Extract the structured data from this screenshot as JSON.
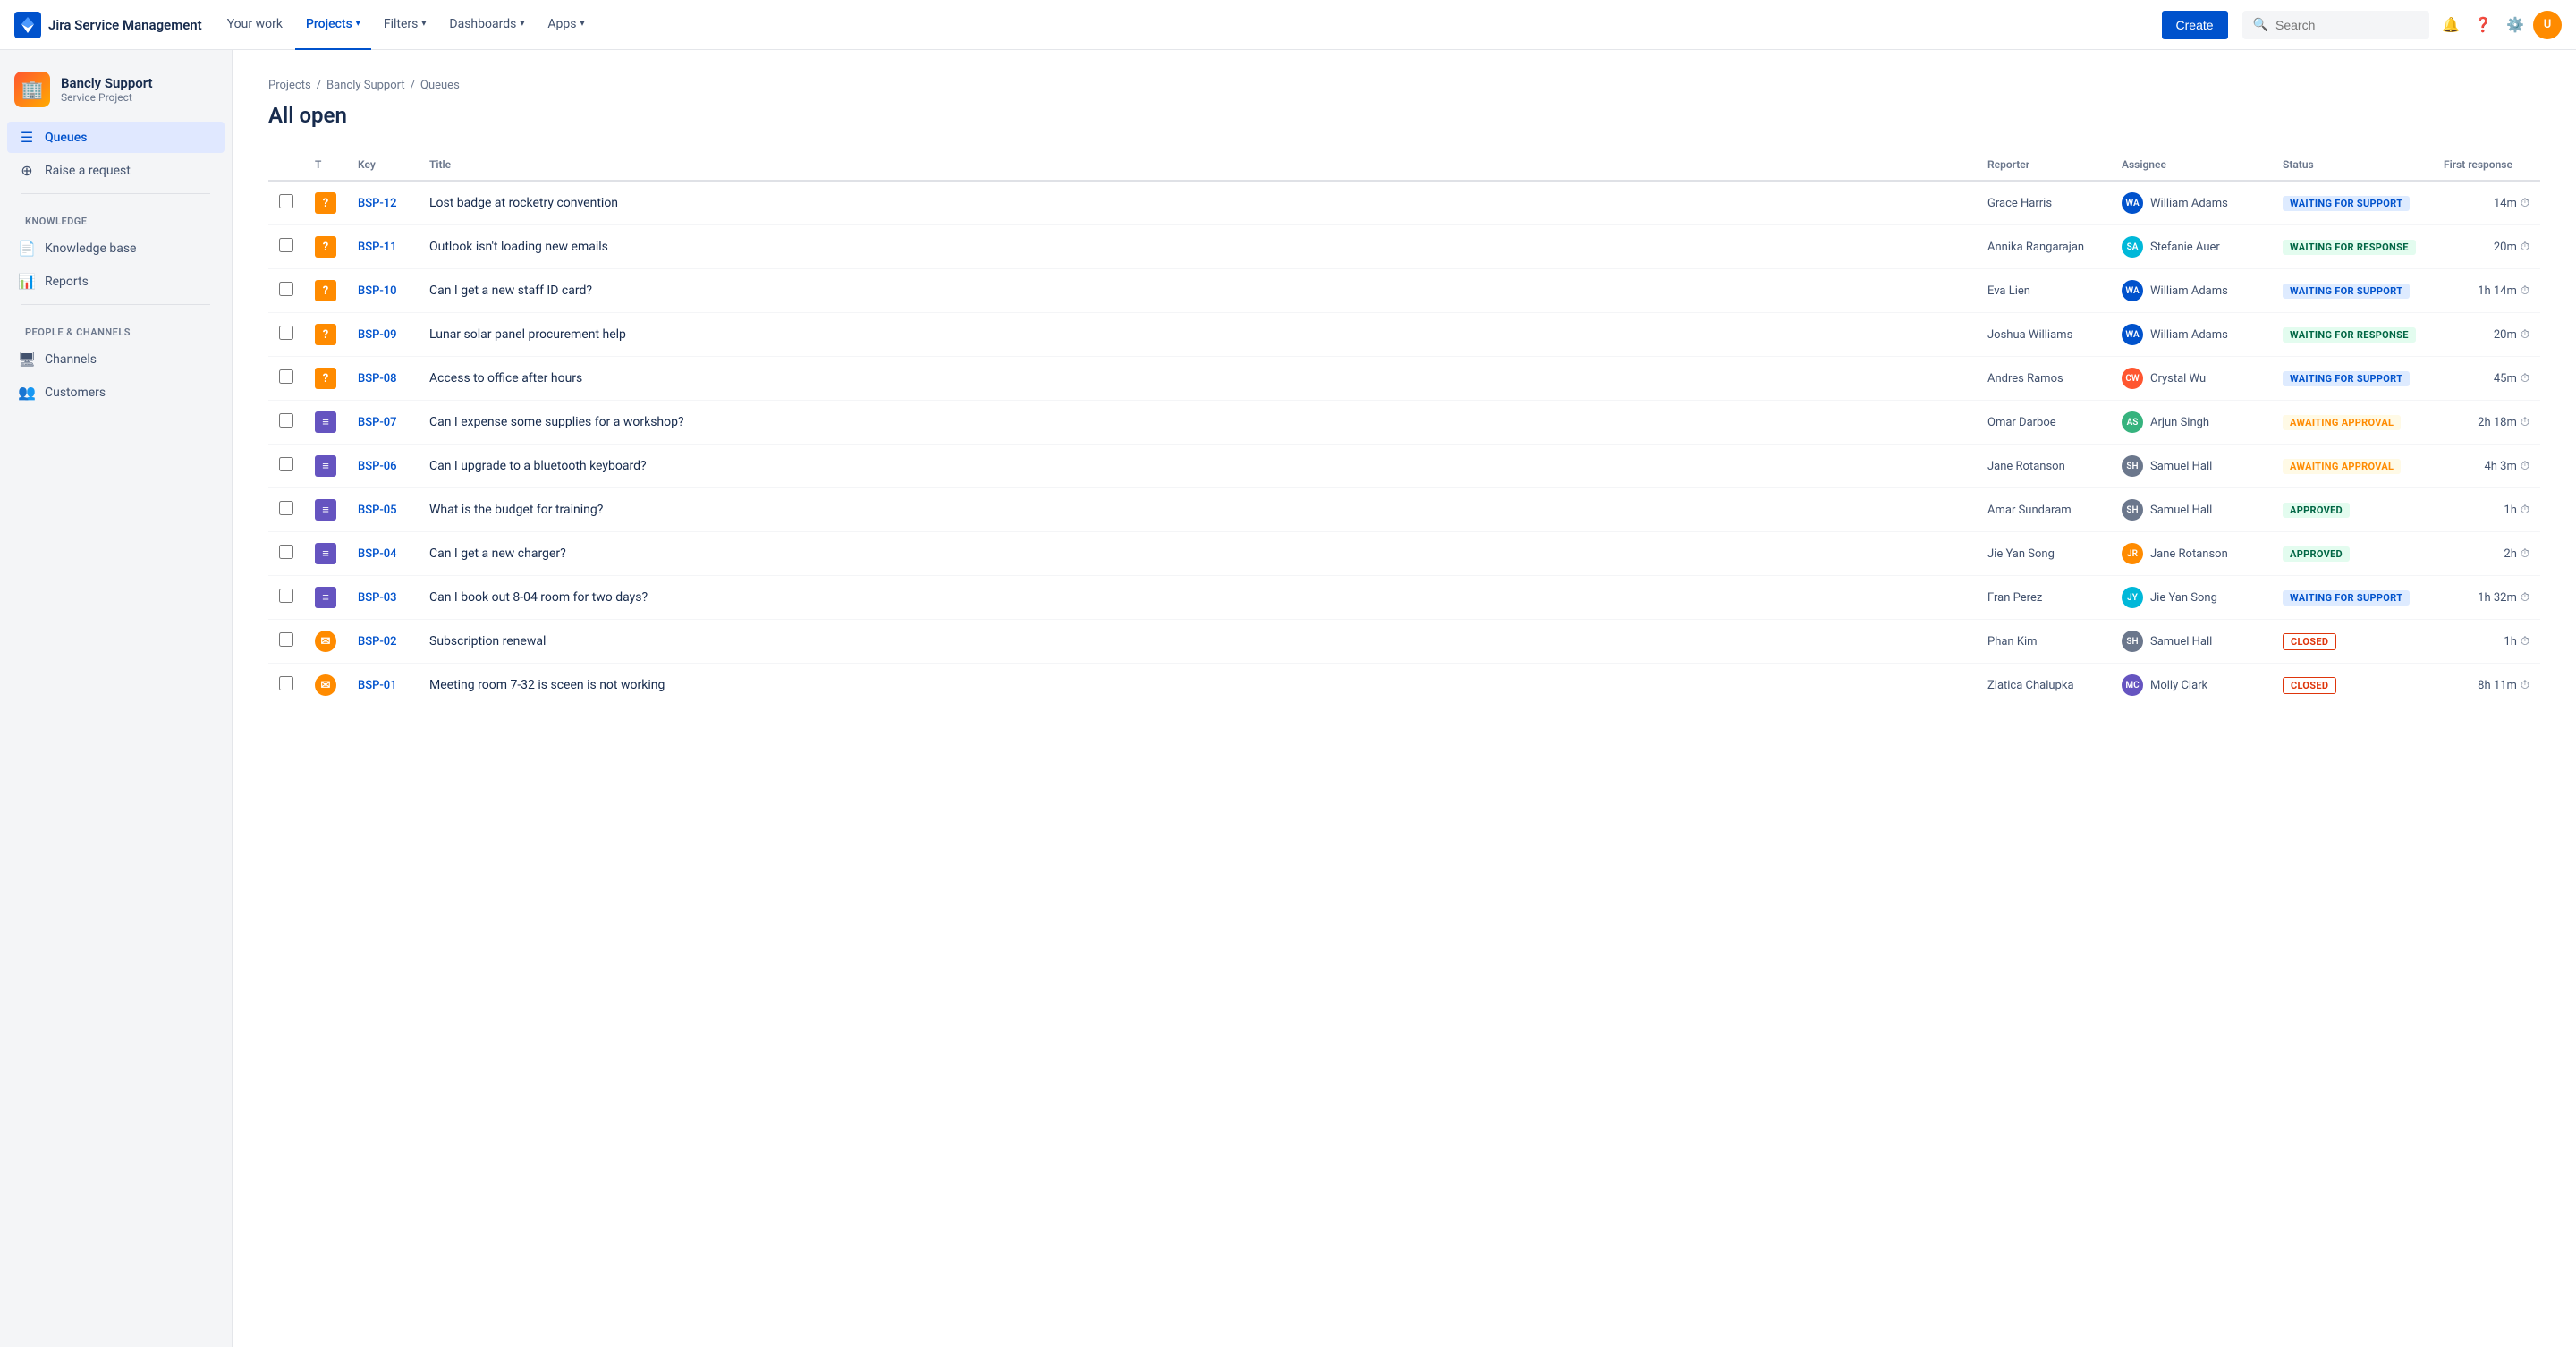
{
  "app": {
    "name": "Jira Service Management",
    "logo_emoji": "⚡"
  },
  "topnav": {
    "your_work": "Your work",
    "projects": "Projects",
    "filters": "Filters",
    "dashboards": "Dashboards",
    "apps": "Apps",
    "create": "Create",
    "search_placeholder": "Search"
  },
  "sidebar": {
    "project_name": "Bancly Support",
    "project_type": "Service Project",
    "items": [
      {
        "label": "Queues",
        "icon": "☰",
        "active": true
      },
      {
        "label": "Raise a request",
        "icon": "⊕",
        "active": false
      }
    ],
    "sections": [
      {
        "label": "KNOWLEDGE",
        "items": [
          {
            "label": "Knowledge base",
            "icon": "📄"
          },
          {
            "label": "Reports",
            "icon": "📊"
          }
        ]
      },
      {
        "label": "PEOPLE & CHANNELS",
        "items": [
          {
            "label": "Channels",
            "icon": "🖥"
          },
          {
            "label": "Customers",
            "icon": "👥"
          }
        ]
      }
    ]
  },
  "breadcrumb": {
    "items": [
      "Projects",
      "Bancly Support",
      "Queues"
    ]
  },
  "page_title": "All open",
  "table": {
    "columns": [
      "",
      "T",
      "Key",
      "Title",
      "Reporter",
      "Assignee",
      "Status",
      "First response"
    ],
    "rows": [
      {
        "key": "BSP-12",
        "type": "question",
        "title": "Lost badge at rocketry convention",
        "reporter": "Grace Harris",
        "assignee": "William Adams",
        "assignee_initials": "WA",
        "assignee_color": "av-blue",
        "status": "WAITING FOR SUPPORT",
        "status_class": "status-waiting-support",
        "first_response": "14m"
      },
      {
        "key": "BSP-11",
        "type": "question",
        "title": "Outlook isn't loading new emails",
        "reporter": "Annika Rangarajan",
        "assignee": "Stefanie Auer",
        "assignee_initials": "SA",
        "assignee_color": "av-teal",
        "status": "WAITING FOR RESPONSE",
        "status_class": "status-waiting-response",
        "first_response": "20m"
      },
      {
        "key": "BSP-10",
        "type": "question",
        "title": "Can I get a new staff ID card?",
        "reporter": "Eva Lien",
        "assignee": "William Adams",
        "assignee_initials": "WA",
        "assignee_color": "av-blue",
        "status": "WAITING FOR SUPPORT",
        "status_class": "status-waiting-support",
        "first_response": "1h 14m"
      },
      {
        "key": "BSP-09",
        "type": "question",
        "title": "Lunar solar panel procurement help",
        "reporter": "Joshua Williams",
        "assignee": "William Adams",
        "assignee_initials": "WA",
        "assignee_color": "av-blue",
        "status": "WAITING FOR RESPONSE",
        "status_class": "status-waiting-response",
        "first_response": "20m"
      },
      {
        "key": "BSP-08",
        "type": "question",
        "title": "Access to office after hours",
        "reporter": "Andres Ramos",
        "assignee": "Crystal Wu",
        "assignee_initials": "CW",
        "assignee_color": "av-pink",
        "status": "WAITING FOR SUPPORT",
        "status_class": "status-waiting-support",
        "first_response": "45m"
      },
      {
        "key": "BSP-07",
        "type": "task",
        "title": "Can I expense some supplies for a workshop?",
        "reporter": "Omar Darboe",
        "assignee": "Arjun Singh",
        "assignee_initials": "AS",
        "assignee_color": "av-green",
        "status": "AWAITING APPROVAL",
        "status_class": "status-awaiting-approval",
        "first_response": "2h 18m"
      },
      {
        "key": "BSP-06",
        "type": "task",
        "title": "Can I upgrade to a bluetooth keyboard?",
        "reporter": "Jane Rotanson",
        "assignee": "Samuel Hall",
        "assignee_initials": "SH",
        "assignee_color": "av-gray",
        "status": "AWAITING APPROVAL",
        "status_class": "status-awaiting-approval",
        "first_response": "4h 3m"
      },
      {
        "key": "BSP-05",
        "type": "task",
        "title": "What is the budget for training?",
        "reporter": "Amar Sundaram",
        "assignee": "Samuel Hall",
        "assignee_initials": "SH",
        "assignee_color": "av-gray",
        "status": "APPROVED",
        "status_class": "status-approved",
        "first_response": "1h"
      },
      {
        "key": "BSP-04",
        "type": "task",
        "title": "Can I get a new charger?",
        "reporter": "Jie Yan Song",
        "assignee": "Jane Rotanson",
        "assignee_initials": "JR",
        "assignee_color": "av-orange",
        "status": "APPROVED",
        "status_class": "status-approved",
        "first_response": "2h"
      },
      {
        "key": "BSP-03",
        "type": "task",
        "title": "Can I book out 8-04 room for two days?",
        "reporter": "Fran Perez",
        "assignee": "Jie Yan Song",
        "assignee_initials": "JY",
        "assignee_color": "av-cyan",
        "status": "WAITING FOR SUPPORT",
        "status_class": "status-waiting-support",
        "first_response": "1h 32m"
      },
      {
        "key": "BSP-02",
        "type": "email",
        "title": "Subscription renewal",
        "reporter": "Phan Kim",
        "assignee": "Samuel Hall",
        "assignee_initials": "SH",
        "assignee_color": "av-gray",
        "status": "CLOSED",
        "status_class": "status-closed",
        "first_response": "1h"
      },
      {
        "key": "BSP-01",
        "type": "email",
        "title": "Meeting room 7-32 is sceen is not working",
        "reporter": "Zlatica Chalupka",
        "assignee": "Molly Clark",
        "assignee_initials": "MC",
        "assignee_color": "av-purple",
        "status": "CLOSED",
        "status_class": "status-closed",
        "first_response": "8h 11m"
      }
    ]
  }
}
